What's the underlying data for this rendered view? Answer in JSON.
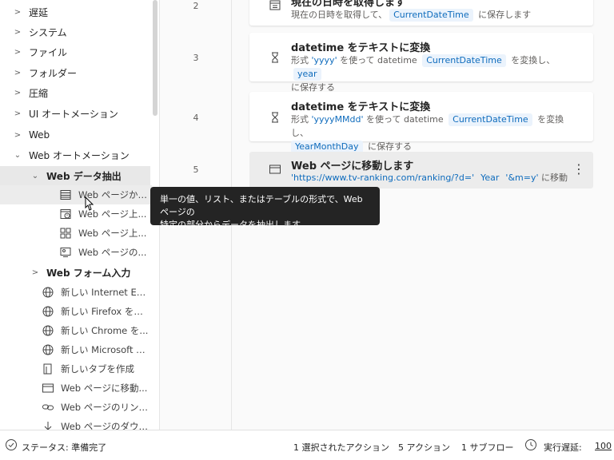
{
  "sidebar": {
    "categories": [
      {
        "label": "遅延"
      },
      {
        "label": "システム"
      },
      {
        "label": "ファイル"
      },
      {
        "label": "フォルダー"
      },
      {
        "label": "圧縮"
      },
      {
        "label": "UI オートメーション"
      },
      {
        "label": "Web"
      },
      {
        "label": "Web オートメーション"
      }
    ],
    "subgroup_extract": {
      "label": "Web データ抽出"
    },
    "extract_items": [
      {
        "label": "Web ページから...",
        "icon": "table-icon"
      },
      {
        "label": "Web ページ上...",
        "icon": "page-clock-icon"
      },
      {
        "label": "Web ページ上...",
        "icon": "grid-icon"
      },
      {
        "label": "Web ページの...",
        "icon": "screenshot-icon"
      }
    ],
    "subgroup_form": {
      "label": "Web フォーム入力"
    },
    "web_items": [
      {
        "label": "新しい Internet Ex...",
        "icon": "globe-icon"
      },
      {
        "label": "新しい Firefox を起...",
        "icon": "globe-icon"
      },
      {
        "label": "新しい Chrome を...",
        "icon": "globe-icon"
      },
      {
        "label": "新しい Microsoft E...",
        "icon": "globe-icon"
      },
      {
        "label": "新しいタブを作成",
        "icon": "new-tab-icon"
      },
      {
        "label": "Web ページに移動...",
        "icon": "browser-window-icon"
      },
      {
        "label": "Web ページのリンク...",
        "icon": "link-icon"
      },
      {
        "label": "Web ページのダウン...",
        "icon": "download-icon"
      }
    ]
  },
  "flow": {
    "steps": [
      {
        "num": "2",
        "title": "現在の日時を取得します",
        "icon": "calendar-icon",
        "desc": {
          "t1": "現在の日時を取得して、",
          "v1": "CurrentDateTime",
          "t2": " に保存します"
        }
      },
      {
        "num": "3",
        "title": "datetime をテキストに変換",
        "icon": "hourglass-icon",
        "desc": {
          "t1": "形式 ",
          "q1": "'yyyy'",
          "t2": " を使って datetime ",
          "v1": "CurrentDateTime",
          "t3": " を変換し、",
          "v2": "year",
          "t4": "に保存する"
        }
      },
      {
        "num": "4",
        "title": "datetime をテキストに変換",
        "icon": "hourglass-icon",
        "desc": {
          "t1": "形式 ",
          "q1": "'yyyyMMdd'",
          "t2": " を使って datetime ",
          "v1": "CurrentDateTime",
          "t3": " を変換し、",
          "v2": "YearMonthDay",
          "t4": " に保存する"
        }
      },
      {
        "num": "5",
        "title": "Web ページに移動します",
        "icon": "browser-window-icon",
        "desc": {
          "q1": "'https://www.tv-ranking.com/ranking/?d='",
          "v1": "Year",
          "q2": "'&m=y'",
          "t1": " に移動"
        },
        "menu": "⋮"
      }
    ]
  },
  "tooltip": {
    "line1": "単一の値、リスト、またはテーブルの形式で、Web ページの",
    "line2": "特定の部分からデータを抽出します"
  },
  "statusbar": {
    "status": "ステータス: 準備完了",
    "selected": "1 選択されたアクション",
    "actions": "5 アクション",
    "subflows": "1 サブフロー",
    "delay_label": "実行遅延:",
    "delay_value": "100"
  },
  "colors": {
    "accent": "#0f6cbd",
    "pill_bg": "#ebf3fc",
    "tooltip_bg": "#242424"
  }
}
